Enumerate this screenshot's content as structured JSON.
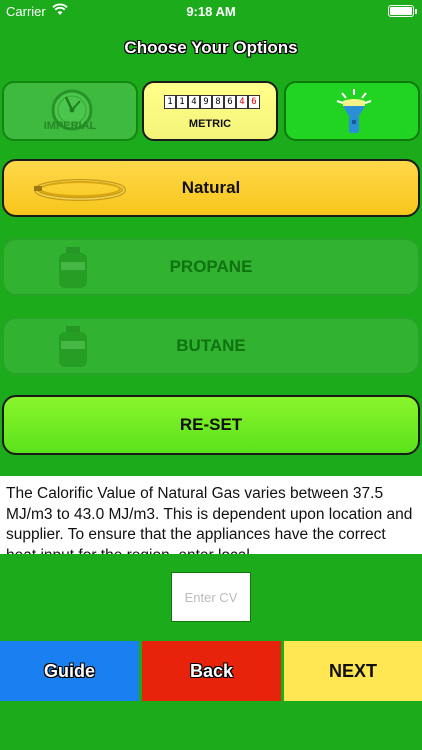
{
  "status_bar": {
    "carrier": "Carrier",
    "time": "9:18 AM"
  },
  "title": "Choose Your Options",
  "units": {
    "imperial_label": "IMPERIAL",
    "metric_label": "METRIC",
    "meter_digits": [
      "1",
      "1",
      "4",
      "9",
      "8",
      "6",
      "4",
      "6"
    ]
  },
  "gas_options": {
    "natural": "Natural",
    "propane": "PROPANE",
    "butane": "BUTANE",
    "reset": "RE-SET"
  },
  "info_text": "The Calorific Value of Natural Gas varies between 37.5 MJ/m3 to 43.0 MJ/m3. This is dependent upon location and supplier. To ensure that the appliances have the correct heat input for the region, enter local",
  "cv_input": {
    "placeholder": "Enter CV",
    "value": ""
  },
  "bottom_buttons": {
    "guide": "Guide",
    "back": "Back",
    "next": "NEXT"
  },
  "colors": {
    "background": "#1bab1b",
    "natural": "#f7c61c",
    "reset": "#5be21c",
    "guide": "#1a7ff0",
    "back": "#e8230c",
    "next": "#ffe653"
  },
  "icons": {
    "imperial": "gauge-dial-icon",
    "metric": "meter-counter-icon",
    "torch": "flashlight-icon",
    "natural": "gas-pipe-coil-icon",
    "propane": "gas-cylinder-icon",
    "butane": "gas-cylinder-icon"
  }
}
